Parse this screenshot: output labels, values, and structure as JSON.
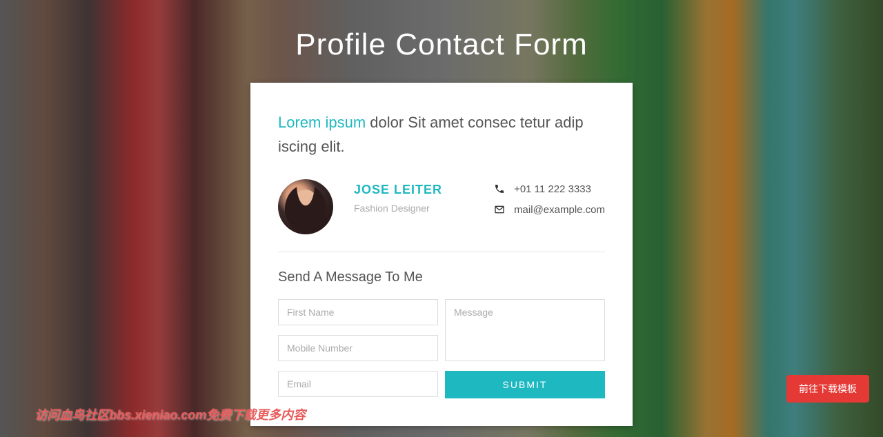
{
  "header": {
    "title": "Profile Contact Form"
  },
  "intro": {
    "highlight": "Lorem ipsum",
    "rest": " dolor Sit amet consec tetur adip iscing elit."
  },
  "profile": {
    "name": "JOSE LEITER",
    "title": "Fashion Designer"
  },
  "contact": {
    "phone": "+01 11 222 3333",
    "email": "mail@example.com"
  },
  "form": {
    "heading": "Send A Message To Me",
    "placeholders": {
      "first_name": "First Name",
      "mobile": "Mobile Number",
      "email": "Email",
      "message": "Message"
    },
    "submit_label": "SUBMIT"
  },
  "watermark": "访问血鸟社区bbs.xieniao.com免费下载更多内容",
  "float_button": "前往下载模板"
}
